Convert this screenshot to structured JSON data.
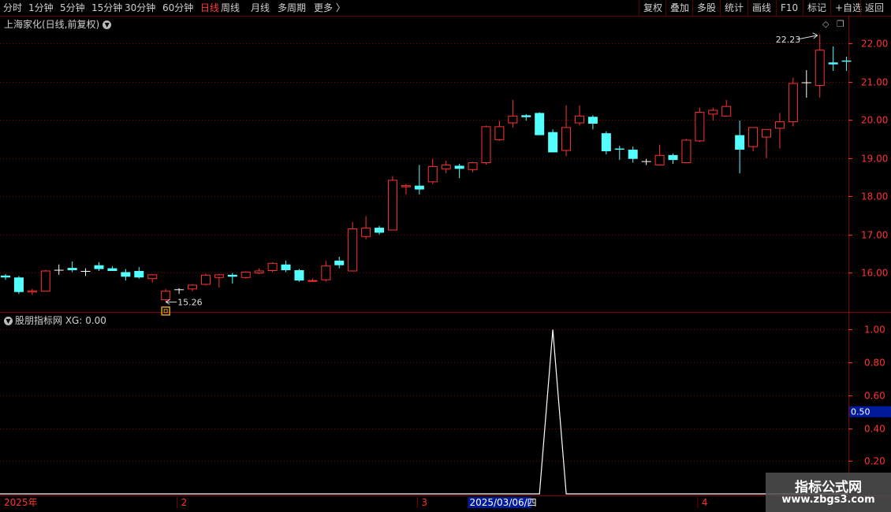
{
  "toolbar": {
    "periods": [
      "分时",
      "1分钟",
      "5分钟",
      "15分钟",
      "30分钟",
      "60分钟",
      "日线",
      "周线",
      "月线",
      "多周期",
      "更多"
    ],
    "active_period": "日线",
    "more_arrow": "〉",
    "actions": [
      "复权",
      "叠加",
      "多股",
      "统计",
      "画线",
      "F10",
      "标记",
      "+自选",
      "返回"
    ]
  },
  "main_panel": {
    "title": "上海家化(日线,前复权)",
    "high_label": "22.23",
    "low_label": "15.26",
    "icons": [
      "diamond-icon",
      "restore-icon"
    ]
  },
  "sub_panel": {
    "title": "股朋指标网 XG: 0.00",
    "cursor_value": "0.50"
  },
  "date_axis": {
    "labels": [
      {
        "text": "2025年",
        "bar": 0
      },
      {
        "text": "2",
        "bar": 13
      },
      {
        "text": "3",
        "bar": 31
      },
      {
        "text": "4",
        "bar": 52
      }
    ],
    "highlight": "2025/03/06/四",
    "highlight_bar": 36
  },
  "watermark": {
    "title": "指标公式网",
    "url": "www.zbgs3.com"
  },
  "colors": {
    "up": "#ff3232",
    "down": "#54ffff",
    "flat": "#ffffff",
    "grid": "#7a0000",
    "axis_text": "#ff3232"
  },
  "chart_data": [
    {
      "type": "candlestick",
      "title": "上海家化(日线,前复权)",
      "ylim": [
        15.0,
        22.35
      ],
      "y_ticks": [
        16.0,
        17.0,
        18.0,
        19.0,
        20.0,
        21.0,
        22.0
      ],
      "ohlc": [
        [
          15.93,
          15.97,
          15.82,
          15.88
        ],
        [
          15.88,
          15.92,
          15.45,
          15.5
        ],
        [
          15.5,
          15.58,
          15.42,
          15.53
        ],
        [
          15.52,
          16.08,
          15.52,
          16.05
        ],
        [
          16.08,
          16.22,
          15.95,
          16.08
        ],
        [
          16.13,
          16.3,
          16.02,
          16.07
        ],
        [
          16.05,
          16.12,
          15.92,
          16.05
        ],
        [
          16.2,
          16.28,
          16.05,
          16.1
        ],
        [
          16.12,
          16.17,
          16.05,
          16.05
        ],
        [
          16.02,
          16.1,
          15.8,
          15.9
        ],
        [
          16.05,
          16.15,
          15.85,
          15.88
        ],
        [
          15.85,
          15.97,
          15.75,
          15.95
        ],
        [
          15.3,
          15.58,
          15.26,
          15.52
        ],
        [
          15.55,
          15.6,
          15.45,
          15.57
        ],
        [
          15.58,
          15.7,
          15.52,
          15.68
        ],
        [
          15.7,
          15.98,
          15.67,
          15.94
        ],
        [
          15.88,
          15.97,
          15.62,
          15.95
        ],
        [
          15.95,
          16.0,
          15.72,
          15.9
        ],
        [
          15.88,
          16.04,
          15.85,
          16.02
        ],
        [
          16.0,
          16.12,
          15.97,
          16.05
        ],
        [
          16.06,
          16.28,
          16.02,
          16.25
        ],
        [
          16.22,
          16.32,
          16.02,
          16.07
        ],
        [
          16.07,
          16.1,
          15.77,
          15.8
        ],
        [
          15.78,
          15.85,
          15.76,
          15.8
        ],
        [
          15.82,
          16.32,
          15.77,
          16.18
        ],
        [
          16.32,
          16.42,
          16.12,
          16.2
        ],
        [
          16.05,
          17.33,
          16.05,
          17.15
        ],
        [
          16.95,
          17.48,
          16.88,
          17.17
        ],
        [
          17.18,
          17.23,
          17.0,
          17.05
        ],
        [
          17.12,
          18.53,
          17.12,
          18.42
        ],
        [
          18.25,
          18.32,
          18.05,
          18.28
        ],
        [
          18.28,
          18.82,
          18.05,
          18.18
        ],
        [
          18.38,
          18.98,
          18.32,
          18.78
        ],
        [
          18.72,
          18.93,
          18.6,
          18.82
        ],
        [
          18.8,
          18.85,
          18.48,
          18.72
        ],
        [
          18.7,
          18.9,
          18.63,
          18.88
        ],
        [
          18.88,
          19.85,
          18.83,
          19.82
        ],
        [
          19.48,
          19.98,
          19.45,
          19.82
        ],
        [
          19.92,
          20.52,
          19.8,
          20.1
        ],
        [
          20.12,
          20.15,
          19.98,
          20.07
        ],
        [
          20.18,
          20.2,
          19.65,
          19.6
        ],
        [
          19.68,
          19.75,
          19.15,
          19.15
        ],
        [
          19.2,
          20.38,
          19.05,
          19.8
        ],
        [
          19.92,
          20.38,
          19.85,
          20.1
        ],
        [
          20.08,
          20.12,
          19.75,
          19.9
        ],
        [
          19.65,
          19.7,
          19.1,
          19.18
        ],
        [
          19.25,
          19.32,
          18.95,
          19.22
        ],
        [
          19.22,
          19.3,
          18.88,
          18.98
        ],
        [
          18.92,
          18.98,
          18.82,
          18.92
        ],
        [
          18.82,
          19.35,
          18.8,
          19.07
        ],
        [
          19.08,
          19.12,
          18.85,
          18.95
        ],
        [
          18.88,
          19.5,
          18.88,
          19.47
        ],
        [
          19.45,
          20.32,
          19.42,
          20.2
        ],
        [
          20.15,
          20.32,
          19.98,
          20.25
        ],
        [
          20.1,
          20.52,
          20.08,
          20.35
        ],
        [
          19.6,
          19.98,
          18.6,
          19.22
        ],
        [
          19.3,
          19.8,
          19.18,
          19.8
        ],
        [
          19.55,
          19.75,
          19.0,
          19.75
        ],
        [
          19.78,
          20.18,
          19.25,
          19.95
        ],
        [
          19.95,
          21.1,
          19.83,
          20.95
        ],
        [
          20.98,
          21.3,
          20.58,
          20.97
        ],
        [
          20.9,
          22.23,
          20.58,
          21.82
        ],
        [
          21.5,
          21.92,
          21.28,
          21.45
        ],
        [
          21.55,
          21.65,
          21.28,
          21.52
        ]
      ]
    },
    {
      "type": "line",
      "title": "股朋指标网 XG: 0.00",
      "name": "XG",
      "ylim": [
        0.0,
        1.05
      ],
      "y_ticks": [
        0.2,
        0.4,
        0.6,
        0.8,
        1.0
      ],
      "values": [
        0,
        0,
        0,
        0,
        0,
        0,
        0,
        0,
        0,
        0,
        0,
        0,
        0,
        0,
        0,
        0,
        0,
        0,
        0,
        0,
        0,
        0,
        0,
        0,
        0,
        0,
        0,
        0,
        0,
        0,
        0,
        0,
        0,
        0,
        0,
        0,
        0,
        0,
        0,
        0,
        0,
        1,
        0,
        0,
        0,
        0,
        0,
        0,
        0,
        0,
        0,
        0,
        0,
        0,
        0,
        0,
        0,
        0,
        0,
        0,
        0,
        0,
        0,
        0
      ]
    }
  ]
}
